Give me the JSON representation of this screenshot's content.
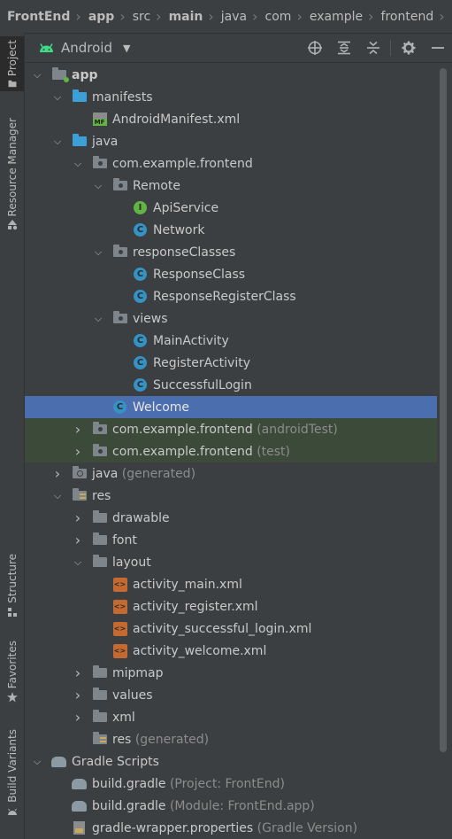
{
  "breadcrumb": [
    "FrontEnd",
    "app",
    "src",
    "main",
    "java",
    "com",
    "example",
    "frontend"
  ],
  "breadcrumb_file_icon": "C",
  "left_strip": {
    "project": "Project",
    "resource_manager": "Resource Manager",
    "structure": "Structure",
    "favorites": "Favorites",
    "build_variants": "Build Variants"
  },
  "toolbar": {
    "view_mode": "Android",
    "icons": [
      "locate-icon",
      "expand-all-icon",
      "collapse-all-icon",
      "gear-icon",
      "minimize-icon"
    ]
  },
  "colors": {
    "selection": "#4b6eaf",
    "test_highlight": "#3c4a3a",
    "class_icon": "#3592c4",
    "interface_icon": "#62b543",
    "xml_icon": "#c46a31"
  },
  "tree": [
    {
      "label": "app",
      "suffix": "",
      "icon": "module",
      "expanded": true,
      "bold": true
    },
    {
      "label": "manifests",
      "suffix": "",
      "icon": "folder-blue",
      "expanded": true
    },
    {
      "label": "AndroidManifest.xml",
      "suffix": "",
      "icon": "MF"
    },
    {
      "label": "java",
      "suffix": "",
      "icon": "folder-blue",
      "expanded": true
    },
    {
      "label": "com.example.frontend",
      "suffix": "",
      "icon": "package",
      "expanded": true
    },
    {
      "label": "Remote",
      "suffix": "",
      "icon": "package",
      "expanded": true
    },
    {
      "label": "ApiService",
      "suffix": "",
      "icon": "I"
    },
    {
      "label": "Network",
      "suffix": "",
      "icon": "C"
    },
    {
      "label": "responseClasses",
      "suffix": "",
      "icon": "package",
      "expanded": true
    },
    {
      "label": "ResponseClass",
      "suffix": "",
      "icon": "C"
    },
    {
      "label": "ResponseRegisterClass",
      "suffix": "",
      "icon": "C"
    },
    {
      "label": "views",
      "suffix": "",
      "icon": "package",
      "expanded": true
    },
    {
      "label": "MainActivity",
      "suffix": "",
      "icon": "C"
    },
    {
      "label": "RegisterActivity",
      "suffix": "",
      "icon": "C"
    },
    {
      "label": "SuccessfulLogin",
      "suffix": "",
      "icon": "C"
    },
    {
      "label": "Welcome",
      "suffix": "",
      "icon": "C",
      "selected": true
    },
    {
      "label": "com.example.frontend",
      "suffix": "(androidTest)",
      "icon": "package",
      "expanded": false,
      "highlight": true
    },
    {
      "label": "com.example.frontend",
      "suffix": "(test)",
      "icon": "package",
      "expanded": false,
      "highlight": true
    },
    {
      "label": "java",
      "suffix": "(generated)",
      "icon": "folder-generated",
      "expanded": false
    },
    {
      "label": "res",
      "suffix": "",
      "icon": "folder-res",
      "expanded": true
    },
    {
      "label": "drawable",
      "suffix": "",
      "icon": "folder",
      "expanded": false
    },
    {
      "label": "font",
      "suffix": "",
      "icon": "folder",
      "expanded": false
    },
    {
      "label": "layout",
      "suffix": "",
      "icon": "folder",
      "expanded": true
    },
    {
      "label": "activity_main.xml",
      "suffix": "",
      "icon": "xml"
    },
    {
      "label": "activity_register.xml",
      "suffix": "",
      "icon": "xml"
    },
    {
      "label": "activity_successful_login.xml",
      "suffix": "",
      "icon": "xml"
    },
    {
      "label": "activity_welcome.xml",
      "suffix": "",
      "icon": "xml"
    },
    {
      "label": "mipmap",
      "suffix": "",
      "icon": "folder",
      "expanded": false
    },
    {
      "label": "values",
      "suffix": "",
      "icon": "folder",
      "expanded": false
    },
    {
      "label": "xml",
      "suffix": "",
      "icon": "folder",
      "expanded": false
    },
    {
      "label": "res",
      "suffix": "(generated)",
      "icon": "folder-res"
    },
    {
      "label": "Gradle Scripts",
      "suffix": "",
      "icon": "gradle",
      "expanded": true
    },
    {
      "label": "build.gradle",
      "suffix": "(Project: FrontEnd)",
      "icon": "gradle"
    },
    {
      "label": "build.gradle",
      "suffix": "(Module: FrontEnd.app)",
      "icon": "gradle"
    },
    {
      "label": "gradle-wrapper.properties",
      "suffix": "(Gradle Version)",
      "icon": "properties"
    }
  ]
}
